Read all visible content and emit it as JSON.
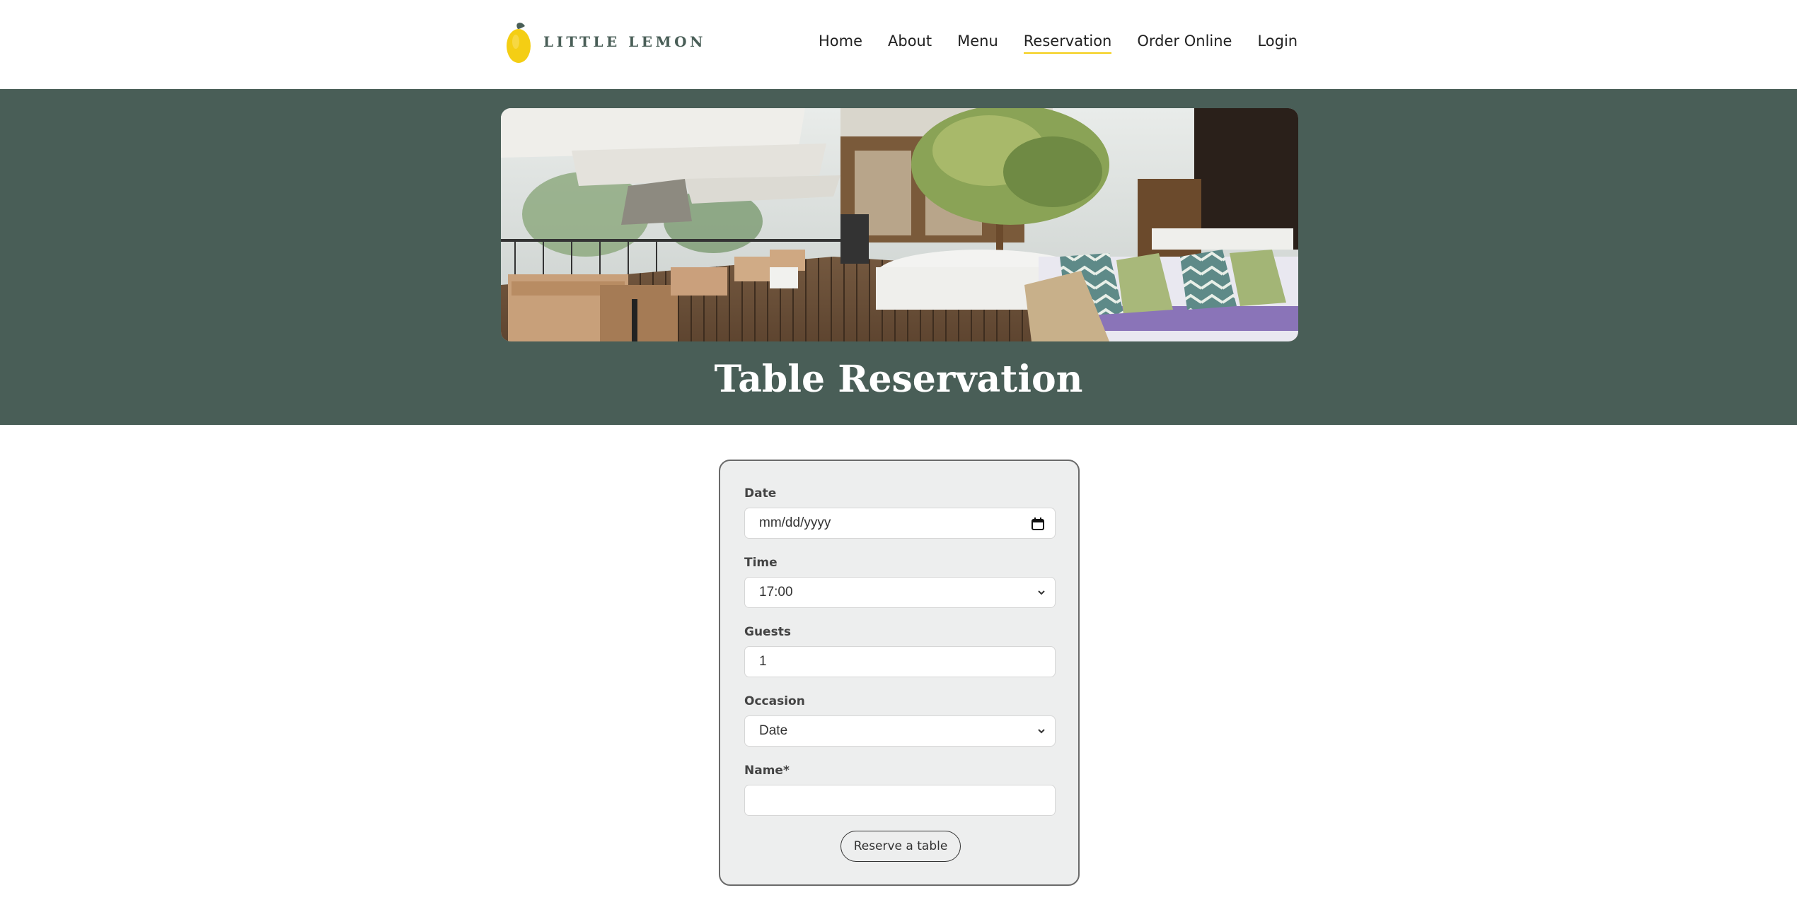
{
  "header": {
    "logo_text": "LITTLE LEMON",
    "nav": [
      {
        "label": "Home",
        "active": false
      },
      {
        "label": "About",
        "active": false
      },
      {
        "label": "Menu",
        "active": false
      },
      {
        "label": "Reservation",
        "active": true
      },
      {
        "label": "Order Online",
        "active": false
      },
      {
        "label": "Login",
        "active": false
      }
    ]
  },
  "hero": {
    "image_name": "restaurant-terrace-photo",
    "title": "Table Reservation"
  },
  "form": {
    "date": {
      "label": "Date",
      "placeholder": "mm/dd/yyyy"
    },
    "time": {
      "label": "Time",
      "value": "17:00"
    },
    "guests": {
      "label": "Guests",
      "value": "1"
    },
    "occasion": {
      "label": "Occasion",
      "value": "Date"
    },
    "name": {
      "label": "Name*",
      "value": ""
    },
    "submit_label": "Reserve a table"
  },
  "colors": {
    "primary_green": "#495e57",
    "accent_yellow": "#f4ce14",
    "form_bg": "#edeeee"
  }
}
